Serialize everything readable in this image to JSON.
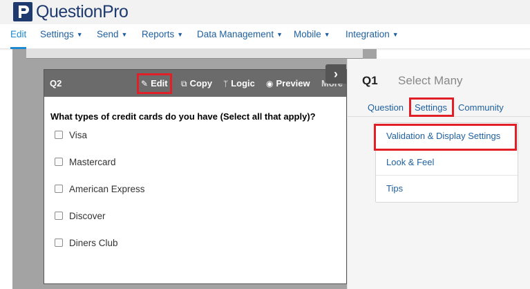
{
  "brand": {
    "name": "QuestionPro"
  },
  "nav": {
    "items": [
      {
        "label": "Edit",
        "dropdown": false,
        "active": true
      },
      {
        "label": "Settings",
        "dropdown": true
      },
      {
        "label": "Send",
        "dropdown": true
      },
      {
        "label": "Reports",
        "dropdown": true
      },
      {
        "label": "Data Management",
        "dropdown": true
      },
      {
        "label": "Mobile",
        "dropdown": true
      },
      {
        "label": "Integration",
        "dropdown": true
      }
    ],
    "chevron": "⌄"
  },
  "question": {
    "number": "Q2",
    "toolbar": {
      "edit": "Edit",
      "copy": "Copy",
      "logic": "Logic",
      "preview": "Preview",
      "more": "More"
    },
    "text": "What types of credit cards do you have (Select all that apply)?",
    "options": [
      "Visa",
      "Mastercard",
      "American Express",
      "Discover",
      "Diners Club"
    ]
  },
  "panel": {
    "question_id": "Q1",
    "question_type": "Select Many",
    "tabs": [
      "Question",
      "Settings",
      "Community"
    ],
    "active_tab": "Settings",
    "settings_items": [
      "Validation & Display Settings",
      "Look & Feel",
      "Tips"
    ]
  },
  "colors": {
    "brand": "#1e3a6e",
    "link": "#1e5f9e",
    "active_nav": "#1e88d0",
    "highlight": "#e21f26",
    "toolbar": "#6b6b6b"
  }
}
